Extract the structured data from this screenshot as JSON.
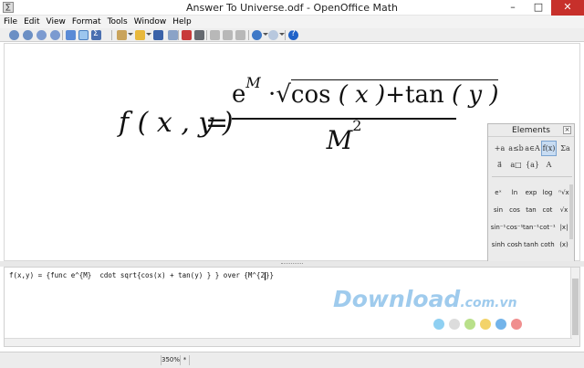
{
  "window": {
    "title": "Answer To Universe.odf - OpenOffice Math",
    "minimize_glyph": "–",
    "maximize_glyph": "□",
    "close_glyph": "✕"
  },
  "menubar": {
    "items": [
      "File",
      "Edit",
      "View",
      "Format",
      "Tools",
      "Window",
      "Help"
    ]
  },
  "toolbar": {
    "icons": [
      "zoom-in-icon",
      "zoom-out-icon",
      "zoom-100-icon",
      "show-all-icon",
      "update-icon",
      "formula-cursor-icon",
      "symbols-icon",
      "templates-icon",
      "open-icon",
      "save-icon",
      "edit-document-icon",
      "export-pdf-icon",
      "print-icon",
      "cut-icon",
      "copy-icon",
      "paste-icon",
      "undo-icon",
      "redo-icon",
      "help-icon"
    ]
  },
  "formula_preview": {
    "lhs": "f ( x , y )",
    "eq": "=",
    "num_e": "e",
    "num_exp": "M",
    "num_cdot": "·",
    "num_sqrt": "√",
    "num_cos": "cos",
    "num_x": " ( x )",
    "num_plus": "+",
    "num_tan": "tan",
    "num_y": " ( y )",
    "den_base": "M",
    "den_exp": "2"
  },
  "elements_panel": {
    "title": "Elements",
    "close_glyph": "×",
    "categories": [
      "+a",
      "a≤b",
      "a∈A",
      "f(x)",
      "Σa",
      "a⃗",
      "a□",
      "{a}",
      "A"
    ],
    "selected_category_index": 3,
    "functions": [
      "eˣ",
      "ln",
      "exp",
      "log",
      "ⁿ√x",
      "sin",
      "cos",
      "tan",
      "cot",
      "√x",
      "sin⁻¹",
      "cos⁻¹",
      "tan⁻¹",
      "cot⁻¹",
      "|x|",
      "sinh",
      "cosh",
      "tanh",
      "coth",
      "(x)"
    ]
  },
  "editor": {
    "text_before_cursor": "f(x,y) = {func e^{M}  cdot sqrt{cos(x) + tan(y) } } over {M^{2",
    "text_after_cursor": "}}"
  },
  "watermark": {
    "brand": "Download",
    "suffix": ".com.vn",
    "dot_colors": [
      "#8fd0f2",
      "#dcdcdc",
      "#b9e08a",
      "#f3d36a",
      "#73b4ea",
      "#f08f8f"
    ]
  },
  "statusbar": {
    "zoom": "350%",
    "modified": "*"
  }
}
